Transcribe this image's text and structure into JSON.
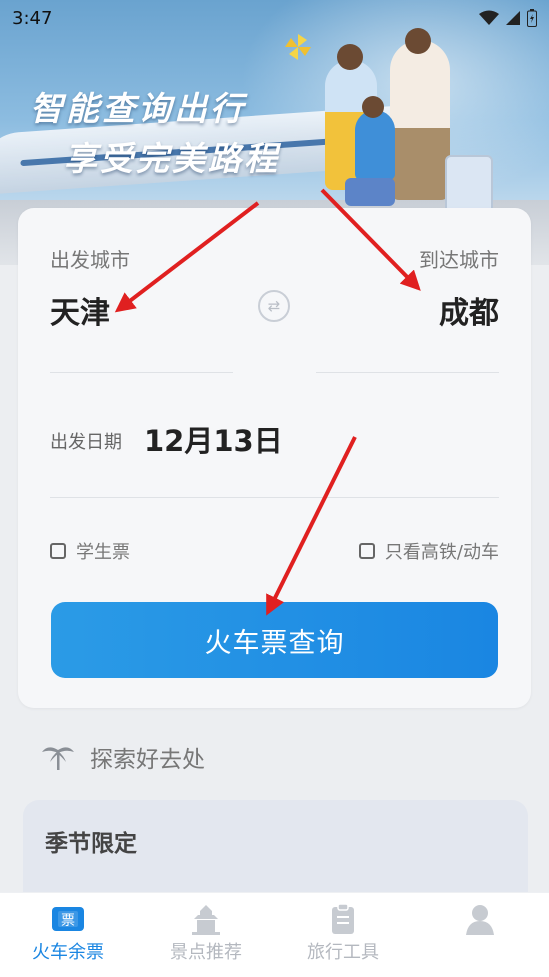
{
  "status_bar": {
    "time": "3:47"
  },
  "hero": {
    "slogan_line1": "智能查询出行",
    "slogan_line2": "享受完美路程"
  },
  "search": {
    "from_label": "出发城市",
    "to_label": "到达城市",
    "from_city": "天津",
    "to_city": "成都",
    "date_label": "出发日期",
    "date_value": "12月13日",
    "student_label": "学生票",
    "high_speed_label": "只看高铁/动车",
    "query_button": "火车票查询"
  },
  "explore": {
    "title": "探索好去处"
  },
  "season": {
    "title": "季节限定"
  },
  "tabs": [
    {
      "label": "火车余票",
      "icon": "ticket-icon",
      "icon_text": "票"
    },
    {
      "label": "景点推荐",
      "icon": "pagoda-icon"
    },
    {
      "label": "旅行工具",
      "icon": "clipboard-icon"
    },
    {
      "label": "",
      "icon": "person-icon"
    }
  ],
  "colors": {
    "accent": "#1a86e2",
    "annotation_arrow": "#e02020"
  }
}
